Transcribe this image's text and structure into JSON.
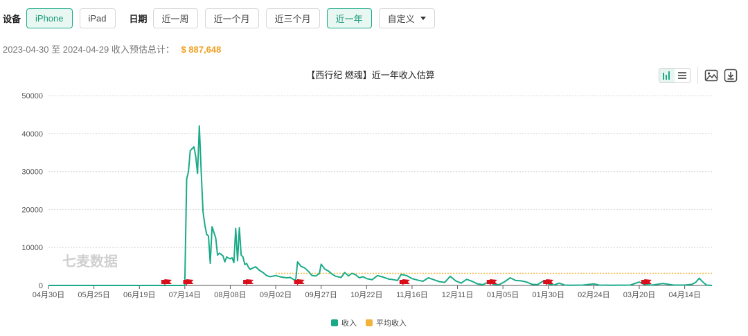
{
  "filters": {
    "device_label": "设备",
    "devices": [
      "iPhone",
      "iPad"
    ],
    "device_active": 0,
    "date_label": "日期",
    "ranges": [
      "近一周",
      "近一个月",
      "近三个月",
      "近一年"
    ],
    "range_active": 3,
    "custom_label": "自定义"
  },
  "summary": {
    "text": "2023-04-30 至 2024-04-29 收入预估总计：",
    "total": "$ 887,648"
  },
  "watermark": "七麦数据",
  "colors": {
    "revenue": "#1aaa88",
    "average": "#f0b43a",
    "flag": "#d9101c",
    "accent": "#1aa987"
  },
  "chart_data": {
    "type": "line",
    "title": "【西行纪 燃魂】近一年收入估算",
    "xlabel": "",
    "ylabel": "",
    "ylim": [
      0,
      50000
    ],
    "yticks": [
      0,
      10000,
      20000,
      30000,
      40000,
      50000
    ],
    "x_start": "2023-04-30",
    "x_end": "2024-04-29",
    "xticks": [
      "04月30日",
      "05月25日",
      "06月19日",
      "07月14日",
      "08月08日",
      "09月02日",
      "09月27日",
      "10月22日",
      "11月16日",
      "12月11日",
      "01月05日",
      "01月30日",
      "02月24日",
      "03月20日",
      "04月14日"
    ],
    "grid": true,
    "legend": "bottom-center",
    "series": [
      {
        "name": "收入",
        "points": [
          [
            "2023-04-30",
            0
          ],
          [
            "2023-07-14",
            0
          ],
          [
            "2023-07-15",
            28000
          ],
          [
            "2023-07-16",
            30000
          ],
          [
            "2023-07-17",
            35500
          ],
          [
            "2023-07-18",
            36000
          ],
          [
            "2023-07-19",
            36500
          ],
          [
            "2023-07-20",
            34000
          ],
          [
            "2023-07-21",
            29500
          ],
          [
            "2023-07-22",
            42000
          ],
          [
            "2023-07-23",
            30000
          ],
          [
            "2023-07-24",
            19500
          ],
          [
            "2023-07-25",
            16000
          ],
          [
            "2023-07-26",
            13500
          ],
          [
            "2023-07-27",
            13000
          ],
          [
            "2023-07-28",
            5800
          ],
          [
            "2023-07-29",
            15500
          ],
          [
            "2023-07-30",
            14000
          ],
          [
            "2023-07-31",
            12500
          ],
          [
            "2023-08-01",
            8000
          ],
          [
            "2023-08-02",
            8500
          ],
          [
            "2023-08-03",
            8200
          ],
          [
            "2023-08-04",
            7800
          ],
          [
            "2023-08-05",
            6200
          ],
          [
            "2023-08-06",
            7500
          ],
          [
            "2023-08-07",
            7200
          ],
          [
            "2023-08-08",
            7000
          ],
          [
            "2023-08-09",
            7300
          ],
          [
            "2023-08-10",
            6000
          ],
          [
            "2023-08-11",
            15000
          ],
          [
            "2023-08-12",
            6500
          ],
          [
            "2023-08-13",
            15200
          ],
          [
            "2023-08-14",
            8000
          ],
          [
            "2023-08-15",
            7500
          ],
          [
            "2023-08-16",
            5500
          ],
          [
            "2023-08-17",
            5800
          ],
          [
            "2023-08-18",
            4800
          ],
          [
            "2023-08-19",
            4200
          ],
          [
            "2023-08-20",
            4500
          ],
          [
            "2023-08-22",
            4900
          ],
          [
            "2023-08-24",
            4000
          ],
          [
            "2023-08-26",
            3400
          ],
          [
            "2023-08-28",
            2600
          ],
          [
            "2023-08-30",
            2300
          ],
          [
            "2023-09-02",
            2600
          ],
          [
            "2023-09-05",
            2200
          ],
          [
            "2023-09-08",
            2000
          ],
          [
            "2023-09-10",
            2100
          ],
          [
            "2023-09-12",
            1500
          ],
          [
            "2023-09-13",
            1400
          ],
          [
            "2023-09-14",
            6200
          ],
          [
            "2023-09-16",
            5000
          ],
          [
            "2023-09-18",
            4600
          ],
          [
            "2023-09-20",
            3700
          ],
          [
            "2023-09-22",
            2600
          ],
          [
            "2023-09-24",
            2500
          ],
          [
            "2023-09-26",
            3100
          ],
          [
            "2023-09-27",
            5600
          ],
          [
            "2023-09-29",
            4300
          ],
          [
            "2023-10-01",
            3800
          ],
          [
            "2023-10-03",
            3000
          ],
          [
            "2023-10-05",
            2400
          ],
          [
            "2023-10-08",
            2100
          ],
          [
            "2023-10-10",
            3400
          ],
          [
            "2023-10-12",
            2500
          ],
          [
            "2023-10-14",
            3200
          ],
          [
            "2023-10-16",
            2800
          ],
          [
            "2023-10-18",
            2000
          ],
          [
            "2023-10-20",
            2300
          ],
          [
            "2023-10-22",
            1800
          ],
          [
            "2023-10-25",
            1500
          ],
          [
            "2023-10-28",
            2600
          ],
          [
            "2023-10-31",
            2200
          ],
          [
            "2023-11-03",
            1700
          ],
          [
            "2023-11-06",
            1500
          ],
          [
            "2023-11-08",
            1300
          ],
          [
            "2023-11-10",
            2900
          ],
          [
            "2023-11-13",
            2600
          ],
          [
            "2023-11-16",
            1800
          ],
          [
            "2023-11-19",
            1400
          ],
          [
            "2023-11-22",
            1100
          ],
          [
            "2023-11-25",
            2000
          ],
          [
            "2023-11-28",
            1500
          ],
          [
            "2023-12-01",
            1000
          ],
          [
            "2023-12-04",
            800
          ],
          [
            "2023-12-07",
            2400
          ],
          [
            "2023-12-10",
            1200
          ],
          [
            "2023-12-13",
            600
          ],
          [
            "2023-12-16",
            1600
          ],
          [
            "2023-12-19",
            1100
          ],
          [
            "2023-12-22",
            400
          ],
          [
            "2023-12-25",
            200
          ],
          [
            "2023-12-28",
            900
          ],
          [
            "2023-12-31",
            300
          ],
          [
            "2024-01-03",
            200
          ],
          [
            "2024-01-06",
            1000
          ],
          [
            "2024-01-09",
            2000
          ],
          [
            "2024-01-12",
            1300
          ],
          [
            "2024-01-15",
            1200
          ],
          [
            "2024-01-18",
            900
          ],
          [
            "2024-01-21",
            300
          ],
          [
            "2024-01-24",
            200
          ],
          [
            "2024-01-27",
            1100
          ],
          [
            "2024-01-30",
            400
          ],
          [
            "2024-02-02",
            100
          ],
          [
            "2024-02-05",
            600
          ],
          [
            "2024-02-08",
            100
          ],
          [
            "2024-02-11",
            50
          ],
          [
            "2024-02-18",
            100
          ],
          [
            "2024-02-24",
            400
          ],
          [
            "2024-02-27",
            100
          ],
          [
            "2024-03-05",
            50
          ],
          [
            "2024-03-15",
            100
          ],
          [
            "2024-03-20",
            900
          ],
          [
            "2024-03-23",
            200
          ],
          [
            "2024-03-27",
            100
          ],
          [
            "2024-04-02",
            500
          ],
          [
            "2024-04-08",
            100
          ],
          [
            "2024-04-14",
            100
          ],
          [
            "2024-04-18",
            300
          ],
          [
            "2024-04-20",
            800
          ],
          [
            "2024-04-22",
            1900
          ],
          [
            "2024-04-24",
            900
          ],
          [
            "2024-04-26",
            100
          ],
          [
            "2024-04-29",
            0
          ]
        ]
      },
      {
        "name": "平均收入",
        "style": "dotted",
        "points": [
          [
            "2023-09-02",
            3200
          ],
          [
            "2024-04-29",
            3200
          ]
        ]
      }
    ],
    "markers": [
      "2023-07-03",
      "2023-07-15",
      "2023-08-17",
      "2023-09-14",
      "2023-11-11",
      "2023-12-29",
      "2024-01-29",
      "2024-03-23"
    ]
  }
}
